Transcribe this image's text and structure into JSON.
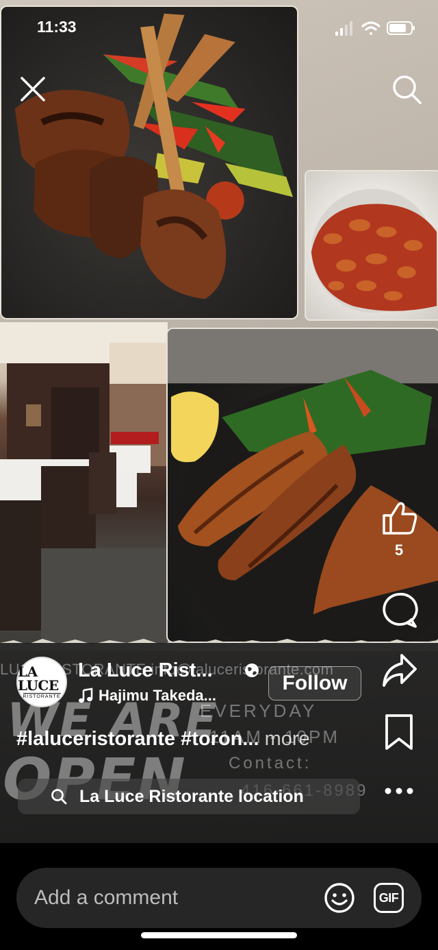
{
  "status": {
    "time": "11:33"
  },
  "post": {
    "account_name": "La Luce Rist...",
    "avatar_text": "LA LUCE",
    "avatar_subtext": "RISTORANTE",
    "follow_label": "Follow",
    "music": "Hajimu Takeda...",
    "caption": "#laluceristorante #toron...",
    "caption_more": "more",
    "location": "La Luce Ristorante location"
  },
  "ad_image": {
    "url_text": "LUCE RISTORANTE  info@laluceristorante.com",
    "big_line1": "WE ARE",
    "big_line2": "OPEN",
    "hours_line1": "EVERYDAY",
    "hours_line2": "11AM - 10PM",
    "contact_label": "Contact:",
    "phone": "416-661-8989"
  },
  "actions": {
    "like_count": "5"
  },
  "comment": {
    "placeholder": "Add a comment",
    "gif_label": "GIF"
  },
  "icons": [
    "close-icon",
    "search-icon",
    "like-icon",
    "comment-icon",
    "share-icon",
    "bookmark-icon",
    "more-icon",
    "music-icon",
    "globe-icon",
    "emoji-icon",
    "gif-icon",
    "wifi-icon",
    "battery-icon",
    "signal-icon"
  ]
}
